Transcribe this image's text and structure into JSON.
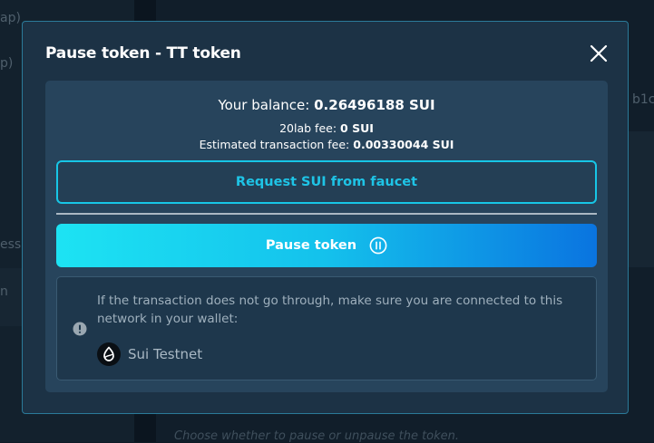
{
  "background": {
    "left_fragments": [
      "ap)",
      "p)",
      "ess",
      "n"
    ],
    "right_fragments": [
      "b1c"
    ],
    "hint": "Choose whether to pause or unpause the token."
  },
  "modal": {
    "title": "Pause token - TT token",
    "close_icon": "close-icon",
    "balance": {
      "label": "Your balance:",
      "value": "0.26496188 SUI"
    },
    "lab_fee": {
      "label": "20lab fee:",
      "value": "0 SUI"
    },
    "tx_fee": {
      "label": "Estimated transaction fee:",
      "value": "0.00330044 SUI"
    },
    "faucet_button": "Request SUI from faucet",
    "pause_button": "Pause token",
    "pause_icon": "pause-circle-icon",
    "notice": {
      "icon": "alert-icon",
      "text": "If the transaction does not go through, make sure you are connected to this network in your wallet:",
      "network_icon": "sui-logo-icon",
      "network": "Sui Testnet"
    }
  },
  "colors": {
    "accent": "#17c6e6",
    "button_gradient_start": "#1de3f3",
    "button_gradient_end": "#0a74e0",
    "modal_bg": "#1c3245",
    "card_bg": "#27445c"
  }
}
